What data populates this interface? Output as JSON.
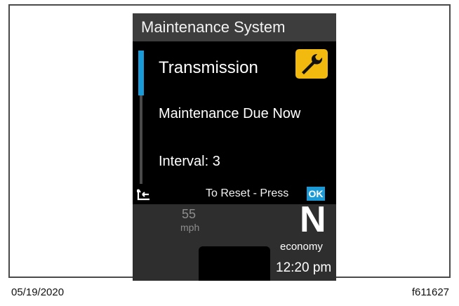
{
  "screen": {
    "title": "Maintenance System",
    "item_name": "Transmission",
    "status": "Maintenance Due Now",
    "interval": "Interval: 3",
    "reset_prompt": "To Reset - Press",
    "ok_label": "OK",
    "icons": {
      "badge": "wrench-icon",
      "back": "back-arrow-icon",
      "scroll": "scroll-down-arrow-icon"
    },
    "colors": {
      "accent": "#1a9ad6",
      "badge": "#f2b90f"
    }
  },
  "cluster": {
    "speed": "55",
    "speed_unit": "mph",
    "gear": "N",
    "mode": "economy",
    "time": "12:20 pm"
  },
  "caption": {
    "date": "05/19/2020",
    "figure_id": "f611627"
  }
}
